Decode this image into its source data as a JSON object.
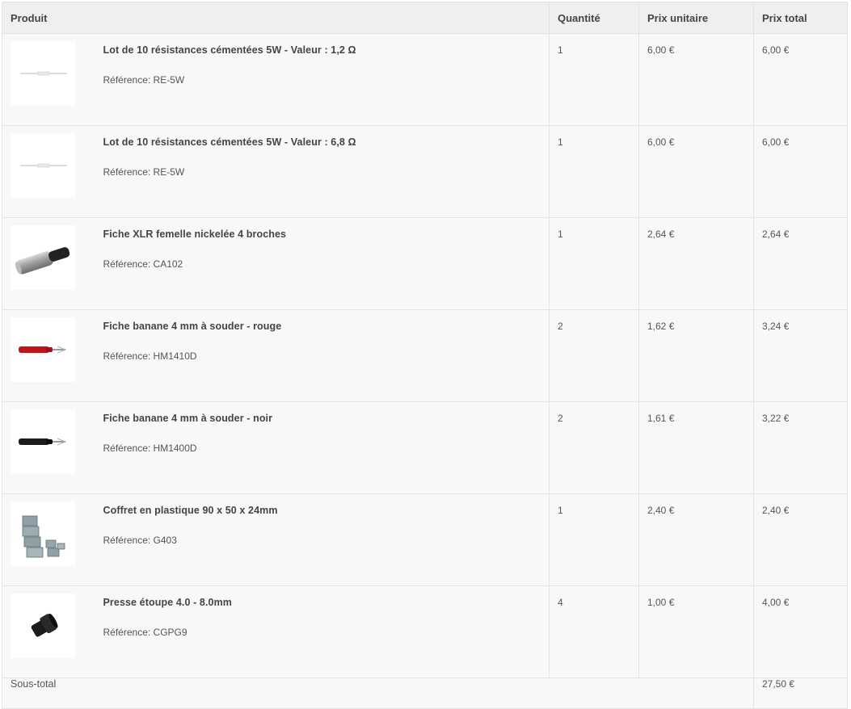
{
  "header": {
    "product": "Produit",
    "quantity": "Quantité",
    "unit_price": "Prix unitaire",
    "total_price": "Prix total"
  },
  "rows": [
    {
      "name": "Lot de 10 résistances cémentées 5W - Valeur : 1,2 Ω",
      "ref_label": "Référence: RE-5W",
      "qty": "1",
      "unit": "6,00 €",
      "total": "6,00 €",
      "image_icon": "resistor-icon"
    },
    {
      "name": "Lot de 10 résistances cémentées 5W - Valeur : 6,8 Ω",
      "ref_label": "Référence: RE-5W",
      "qty": "1",
      "unit": "6,00 €",
      "total": "6,00 €",
      "image_icon": "resistor-icon"
    },
    {
      "name": "Fiche XLR femelle nickelée 4 broches",
      "ref_label": "Référence: CA102",
      "qty": "1",
      "unit": "2,64 €",
      "total": "2,64 €",
      "image_icon": "xlr-connector-icon"
    },
    {
      "name": "Fiche banane 4 mm à souder - rouge",
      "ref_label": "Référence: HM1410D",
      "qty": "2",
      "unit": "1,62 €",
      "total": "3,24 €",
      "image_icon": "banana-plug-red-icon"
    },
    {
      "name": "Fiche banane 4 mm à souder - noir",
      "ref_label": "Référence: HM1400D",
      "qty": "2",
      "unit": "1,61 €",
      "total": "3,22 €",
      "image_icon": "banana-plug-black-icon"
    },
    {
      "name": "Coffret en plastique 90 x 50 x 24mm",
      "ref_label": "Référence: G403",
      "qty": "1",
      "unit": "2,40 €",
      "total": "2,40 €",
      "image_icon": "plastic-enclosure-icon"
    },
    {
      "name": "Presse étoupe 4.0 - 8.0mm",
      "ref_label": "Référence: CGPG9",
      "qty": "4",
      "unit": "1,00 €",
      "total": "4,00 €",
      "image_icon": "cable-gland-icon"
    }
  ],
  "footer": {
    "subtotal_label": "Sous-total",
    "subtotal_value": "27,50 €"
  },
  "colors": {
    "header_bg": "#efefef",
    "row_bg": "#f8f8f8",
    "border": "#e3e3e3",
    "text": "#444444"
  }
}
